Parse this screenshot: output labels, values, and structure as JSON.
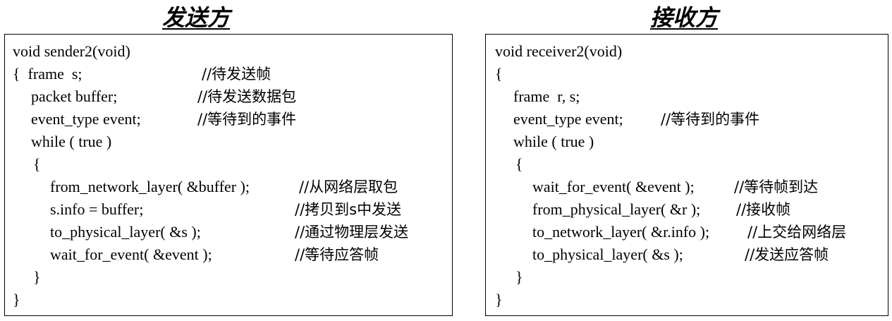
{
  "sender": {
    "title": "发送方",
    "lines": [
      {
        "code": "void sender2(void)",
        "comment": ""
      },
      {
        "code": "{  frame  s;",
        "comment": "//待发送帧"
      },
      {
        "code": "packet buffer;",
        "comment": "//待发送数据包"
      },
      {
        "code": "event_type event;",
        "comment": "//等待到的事件"
      },
      {
        "code": "while ( true )",
        "comment": ""
      },
      {
        "code": "{",
        "comment": ""
      },
      {
        "code": "from_network_layer( &buffer );",
        "comment": "//从网络层取包"
      },
      {
        "code": "s.info = buffer;",
        "comment": "//拷贝到s中发送"
      },
      {
        "code": "to_physical_layer( &s );",
        "comment": "//通过物理层发送"
      },
      {
        "code": "wait_for_event( &event );",
        "comment": "//等待应答帧"
      },
      {
        "code": "}",
        "comment": ""
      },
      {
        "code": "}",
        "comment": ""
      }
    ]
  },
  "receiver": {
    "title": "接收方",
    "lines": [
      {
        "code": "void receiver2(void)",
        "comment": ""
      },
      {
        "code": "{",
        "comment": ""
      },
      {
        "code": "frame  r, s;",
        "comment": ""
      },
      {
        "code": "event_type event;",
        "comment": "//等待到的事件"
      },
      {
        "code": "while ( true )",
        "comment": ""
      },
      {
        "code": "{",
        "comment": ""
      },
      {
        "code": "wait_for_event( &event );",
        "comment": "//等待帧到达"
      },
      {
        "code": "from_physical_layer( &r );",
        "comment": "//接收帧"
      },
      {
        "code": "to_network_layer( &r.info );",
        "comment": "//上交给网络层"
      },
      {
        "code": "to_physical_layer( &s );",
        "comment": "//发送应答帧"
      },
      {
        "code": "}",
        "comment": ""
      },
      {
        "code": "}",
        "comment": ""
      }
    ]
  }
}
